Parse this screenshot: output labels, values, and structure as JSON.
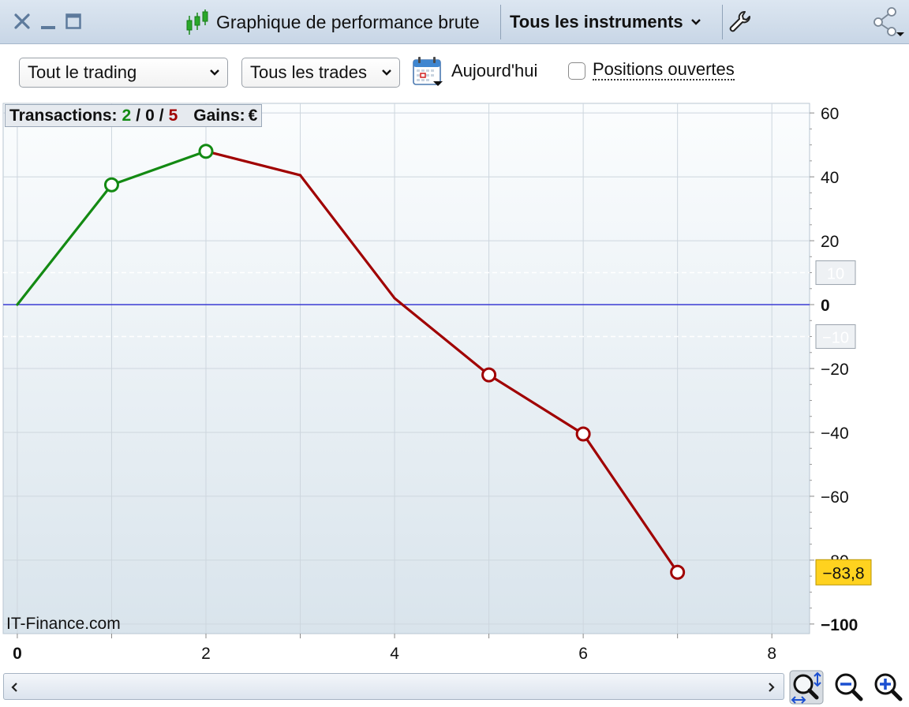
{
  "window": {
    "title": "Graphique de performance brute",
    "instrument_selector": "Tous les instruments"
  },
  "toolbar": {
    "trading_filter": "Tout le trading",
    "trades_filter": "Tous les trades",
    "date_label": "Aujourd'hui",
    "open_positions_label": "Positions ouvertes",
    "open_positions_checked": false
  },
  "stats": {
    "transactions_label": "Transactions:",
    "winning": "2",
    "neutral": "0",
    "losing": "5",
    "separator": "/",
    "gains_label": "Gains:",
    "currency": "€"
  },
  "watermark": "IT-Finance.com",
  "colors": {
    "gain": "#138a13",
    "loss": "#a00000",
    "zero_line": "#2a2ad0",
    "last_value_badge": "#ffd21f"
  },
  "chart_data": {
    "type": "line",
    "x": [
      0,
      1,
      2,
      3,
      4,
      5,
      6,
      7
    ],
    "y": [
      0,
      37.5,
      48,
      40.5,
      2,
      -22,
      -40.5,
      -83.8
    ],
    "markers_at": [
      1,
      2,
      5,
      6,
      7
    ],
    "xlim": [
      -0.15,
      8.4
    ],
    "ylim": [
      -103,
      63
    ],
    "x_ticks": [
      0,
      2,
      4,
      6,
      8
    ],
    "x_tick_labels": [
      "0",
      "2",
      "4",
      "6",
      "8"
    ],
    "y_ticks": [
      60,
      40,
      20,
      0,
      -20,
      -40,
      -60,
      -80,
      -100
    ],
    "y_tick_labels": [
      "60",
      "40",
      "20",
      "0",
      "−20",
      "−40",
      "−60",
      "−80",
      "−100"
    ],
    "bold_tick_labels": [
      "0",
      "−100"
    ],
    "dashed_levels": [
      10,
      -10
    ],
    "dashed_level_labels": [
      "10",
      "−10"
    ],
    "last_value_label": "−83,8",
    "grid": true,
    "y_axis_side": "right"
  },
  "zoom": {
    "fit": "zoom-fit-icon",
    "out": "zoom-out-icon",
    "in": "zoom-in-icon"
  }
}
